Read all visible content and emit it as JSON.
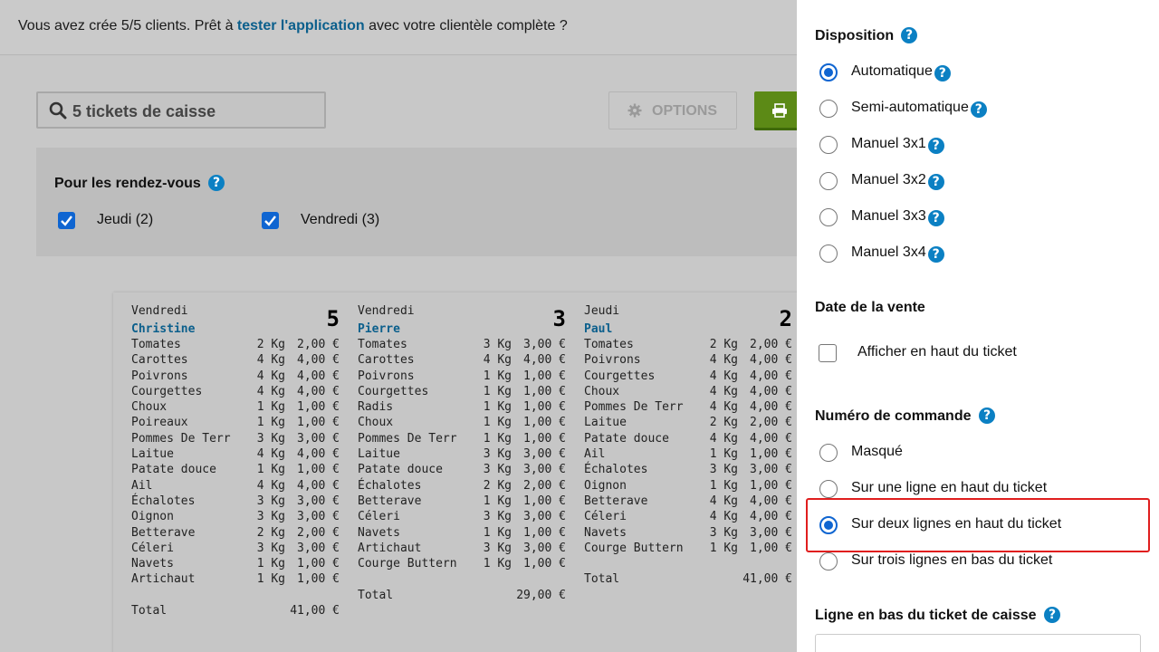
{
  "banner": {
    "text_before": "Vous avez crée 5/5 clients. Prêt à ",
    "link": "tester l'application",
    "text_after": " avec votre clientèle complète ?"
  },
  "search": {
    "value": "5 tickets de caisse",
    "icon": "search-icon"
  },
  "toolbar": {
    "options_label": "OPTIONS",
    "options_icon": "gear-icon",
    "print_icon": "printer-icon"
  },
  "filter": {
    "title": "Pour les rendez-vous",
    "options": [
      {
        "label": "Jeudi (2)",
        "checked": true
      },
      {
        "label": "Vendredi (3)",
        "checked": true
      }
    ]
  },
  "tickets": [
    {
      "day": "Vendredi",
      "name": "Christine",
      "number": "5",
      "items": [
        [
          "Tomates",
          "2 Kg",
          "2,00 €"
        ],
        [
          "Carottes",
          "4 Kg",
          "4,00 €"
        ],
        [
          "Poivrons",
          "4 Kg",
          "4,00 €"
        ],
        [
          "Courgettes",
          "4 Kg",
          "4,00 €"
        ],
        [
          "Choux",
          "1 Kg",
          "1,00 €"
        ],
        [
          "Poireaux",
          "1 Kg",
          "1,00 €"
        ],
        [
          "Pommes De Terr",
          "3 Kg",
          "3,00 €"
        ],
        [
          "Laitue",
          "4 Kg",
          "4,00 €"
        ],
        [
          "Patate douce",
          "1 Kg",
          "1,00 €"
        ],
        [
          "Ail",
          "4 Kg",
          "4,00 €"
        ],
        [
          "Échalotes",
          "3 Kg",
          "3,00 €"
        ],
        [
          "Oignon",
          "3 Kg",
          "3,00 €"
        ],
        [
          "Betterave",
          "2 Kg",
          "2,00 €"
        ],
        [
          "Céleri",
          "3 Kg",
          "3,00 €"
        ],
        [
          "Navets",
          "1 Kg",
          "1,00 €"
        ],
        [
          "Artichaut",
          "1 Kg",
          "1,00 €"
        ]
      ],
      "total_label": "Total",
      "total": "41,00 €"
    },
    {
      "day": "Vendredi",
      "name": "Pierre",
      "number": "3",
      "items": [
        [
          "Tomates",
          "3 Kg",
          "3,00 €"
        ],
        [
          "Carottes",
          "4 Kg",
          "4,00 €"
        ],
        [
          "Poivrons",
          "1 Kg",
          "1,00 €"
        ],
        [
          "Courgettes",
          "1 Kg",
          "1,00 €"
        ],
        [
          "Radis",
          "1 Kg",
          "1,00 €"
        ],
        [
          "Choux",
          "1 Kg",
          "1,00 €"
        ],
        [
          "Pommes De Terr",
          "1 Kg",
          "1,00 €"
        ],
        [
          "Laitue",
          "3 Kg",
          "3,00 €"
        ],
        [
          "Patate douce",
          "3 Kg",
          "3,00 €"
        ],
        [
          "Échalotes",
          "2 Kg",
          "2,00 €"
        ],
        [
          "Betterave",
          "1 Kg",
          "1,00 €"
        ],
        [
          "Céleri",
          "3 Kg",
          "3,00 €"
        ],
        [
          "Navets",
          "1 Kg",
          "1,00 €"
        ],
        [
          "Artichaut",
          "3 Kg",
          "3,00 €"
        ],
        [
          "Courge Buttern",
          "1 Kg",
          "1,00 €"
        ]
      ],
      "total_label": "Total",
      "total": "29,00 €"
    },
    {
      "day": "Jeudi",
      "name": "Paul",
      "number": "2",
      "items": [
        [
          "Tomates",
          "2 Kg",
          "2,00 €"
        ],
        [
          "Poivrons",
          "4 Kg",
          "4,00 €"
        ],
        [
          "Courgettes",
          "4 Kg",
          "4,00 €"
        ],
        [
          "Choux",
          "4 Kg",
          "4,00 €"
        ],
        [
          "Pommes De Terr",
          "4 Kg",
          "4,00 €"
        ],
        [
          "Laitue",
          "2 Kg",
          "2,00 €"
        ],
        [
          "Patate douce",
          "4 Kg",
          "4,00 €"
        ],
        [
          "Ail",
          "1 Kg",
          "1,00 €"
        ],
        [
          "Échalotes",
          "3 Kg",
          "3,00 €"
        ],
        [
          "Oignon",
          "1 Kg",
          "1,00 €"
        ],
        [
          "Betterave",
          "4 Kg",
          "4,00 €"
        ],
        [
          "Céleri",
          "4 Kg",
          "4,00 €"
        ],
        [
          "Navets",
          "3 Kg",
          "3,00 €"
        ],
        [
          "Courge Buttern",
          "1 Kg",
          "1,00 €"
        ]
      ],
      "total_label": "Total",
      "total": "41,00 €"
    }
  ],
  "sidebar": {
    "disposition": {
      "title": "Disposition",
      "options": [
        {
          "label": "Automatique",
          "selected": true
        },
        {
          "label": "Semi-automatique",
          "selected": false
        },
        {
          "label": "Manuel 3x1",
          "selected": false
        },
        {
          "label": "Manuel 3x2",
          "selected": false
        },
        {
          "label": "Manuel 3x3",
          "selected": false
        },
        {
          "label": "Manuel 3x4",
          "selected": false
        }
      ]
    },
    "date": {
      "title": "Date de la vente",
      "checkbox_label": "Afficher en haut du ticket",
      "checked": false
    },
    "order_number": {
      "title": "Numéro de commande",
      "options": [
        {
          "label": "Masqué",
          "selected": false
        },
        {
          "label": "Sur une ligne en haut du ticket",
          "selected": false
        },
        {
          "label": "Sur deux lignes en haut du ticket",
          "selected": true
        },
        {
          "label": "Sur trois lignes en bas du ticket",
          "selected": false
        }
      ]
    },
    "bottom_line": {
      "title": "Ligne en bas du ticket de caisse"
    }
  },
  "colors": {
    "accent": "#0f65d1",
    "help": "#0b80c3",
    "link": "#0b5f8c",
    "print": "#5c8a16",
    "highlight": "#e01e1e"
  }
}
